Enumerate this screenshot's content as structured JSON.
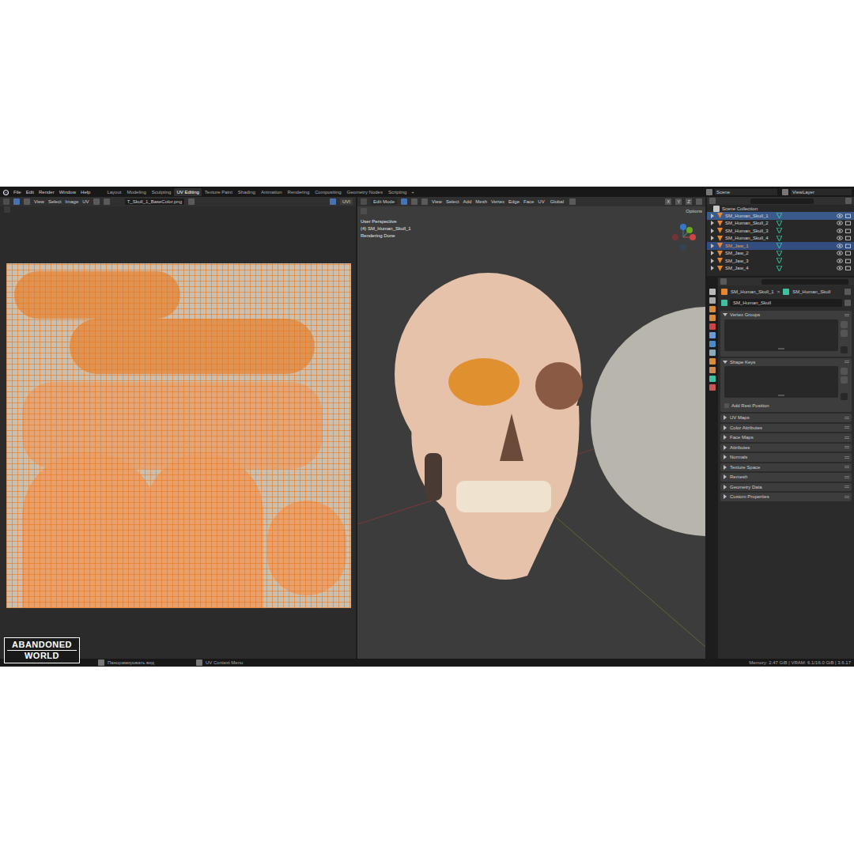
{
  "topbar": {
    "menus": [
      "File",
      "Edit",
      "Render",
      "Window",
      "Help"
    ],
    "workspaces": [
      {
        "label": "Layout",
        "selected": false
      },
      {
        "label": "Modeling",
        "selected": false
      },
      {
        "label": "Sculpting",
        "selected": false
      },
      {
        "label": "UV Editing",
        "selected": true
      },
      {
        "label": "Texture Paint",
        "selected": false
      },
      {
        "label": "Shading",
        "selected": false
      },
      {
        "label": "Animation",
        "selected": false
      },
      {
        "label": "Rendering",
        "selected": false
      },
      {
        "label": "Compositing",
        "selected": false
      },
      {
        "label": "Geometry Nodes",
        "selected": false
      },
      {
        "label": "Scripting",
        "selected": false
      }
    ],
    "add": "+",
    "scene": "Scene",
    "view_layer": "ViewLayer"
  },
  "uv_editor": {
    "menus": [
      "View",
      "Select",
      "Image",
      "UV"
    ],
    "image_name": "T_Skull_1_BaseColor.png",
    "uv_map": "UVI"
  },
  "viewport": {
    "mode": "Edit Mode",
    "menus": [
      "View",
      "Select",
      "Add",
      "Mesh",
      "Vertex",
      "Edge",
      "Face",
      "UV"
    ],
    "orientation": "Global",
    "mirror_axes": [
      "X",
      "Y",
      "Z"
    ],
    "options": "Options",
    "overlay": [
      "User Perspective",
      "(4) SM_Human_Skull_1",
      "Rendering Done"
    ]
  },
  "outliner": {
    "root": "Scene Collection",
    "items": [
      {
        "name": "SM_Human_Skull_1",
        "selected": true,
        "active": false
      },
      {
        "name": "SM_Human_Skull_2",
        "selected": false,
        "active": false
      },
      {
        "name": "SM_Human_Skull_3",
        "selected": false,
        "active": false
      },
      {
        "name": "SM_Human_Skull_4",
        "selected": false,
        "active": false
      },
      {
        "name": "SM_Jaw_1",
        "selected": true,
        "active": true
      },
      {
        "name": "SM_Jaw_2",
        "selected": false,
        "active": false
      },
      {
        "name": "SM_Jaw_3",
        "selected": false,
        "active": false
      },
      {
        "name": "SM_Jaw_4",
        "selected": false,
        "active": false
      }
    ]
  },
  "properties": {
    "breadcrumb": [
      "SM_Human_Skull_1",
      "SM_Human_Skull"
    ],
    "separator": ">",
    "data_name": "SM_Human_Skull",
    "panels": [
      {
        "title": "Vertex Groups",
        "expanded": true
      },
      {
        "title": "Shape Keys",
        "expanded": true,
        "option": {
          "label": "Add Rest Position",
          "checked": false
        }
      },
      {
        "title": "UV Maps",
        "expanded": false
      },
      {
        "title": "Color Attributes",
        "expanded": false
      },
      {
        "title": "Face Maps",
        "expanded": false
      },
      {
        "title": "Attributes",
        "expanded": false
      },
      {
        "title": "Normals",
        "expanded": false
      },
      {
        "title": "Texture Space",
        "expanded": false
      },
      {
        "title": "Remesh",
        "expanded": false
      },
      {
        "title": "Geometry Data",
        "expanded": false
      },
      {
        "title": "Custom Properties",
        "expanded": false
      }
    ]
  },
  "status_bar": {
    "left": [
      "Панорамировать вид",
      "UV Context Menu"
    ],
    "right": "Memory: 2.47 GiB | VRAM: 6.1/16.0 GiB | 3.6.17"
  },
  "watermark": {
    "lines": [
      "ABANDONED",
      "WORLD"
    ]
  }
}
